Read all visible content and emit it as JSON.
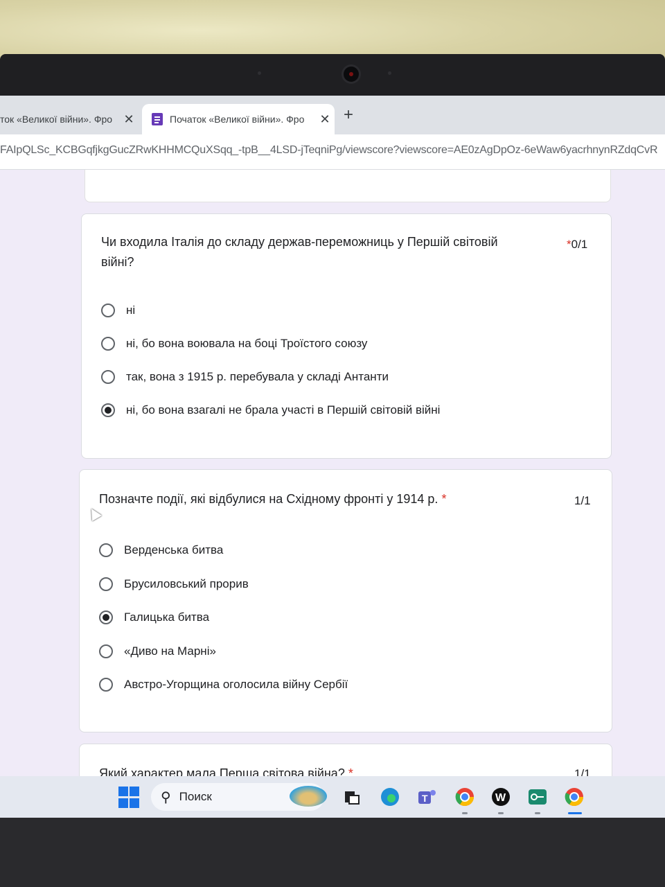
{
  "browser": {
    "tabs": [
      {
        "title": "ток «Великої війни». Фро",
        "active": false
      },
      {
        "title": "Початок «Великої війни». Фро",
        "active": true
      }
    ],
    "new_tab_label": "+",
    "close_label": "✕",
    "url": "FAIpQLSc_KCBGqfjkgGucZRwKHHMCQuXSqq_-tpB__4LSD-jTeqniPg/viewscore?viewscore=AE0zAgDpOz-6eWaw6yacrhnynRZdqCvR"
  },
  "questions": [
    {
      "title_line1": "Чи входила Італія до складу держав-переможниць у Першій світовій",
      "title_line2": "війні?",
      "required_mark": "*",
      "score": "0/1",
      "options": [
        {
          "label": "ні",
          "checked": false
        },
        {
          "label": "ні, бо вона воювала на боці Троїстого союзу",
          "checked": false
        },
        {
          "label": "так, вона з 1915 р. перебувала у складі Антанти",
          "checked": false
        },
        {
          "label": "ні, бо вона взагалі не брала участі в Першій світовій війні",
          "checked": true
        }
      ]
    },
    {
      "title": "Позначте події, які відбулися на Східному фронті у 1914 р.",
      "required_mark": "*",
      "score": "1/1",
      "options": [
        {
          "label": "Верденська битва",
          "checked": false
        },
        {
          "label": "Брусиловський прорив",
          "checked": false
        },
        {
          "label": "Галицька битва",
          "checked": true
        },
        {
          "label": "«Диво на Марні»",
          "checked": false
        },
        {
          "label": "Австро-Угорщина оголосила війну Сербії",
          "checked": false
        }
      ]
    },
    {
      "title": "Який характер мала Перша світова війна?",
      "required_mark": "*",
      "score": "1/1"
    }
  ],
  "taskbar": {
    "search_label": "Поиск",
    "icons": [
      "windows-start-icon",
      "search-icon",
      "widgets-island-icon",
      "task-view-icon",
      "edge-icon",
      "teams-icon",
      "chrome-profile-icon",
      "w-app-icon",
      "password-manager-icon",
      "chrome-icon"
    ],
    "accent": "#1a73e8"
  }
}
